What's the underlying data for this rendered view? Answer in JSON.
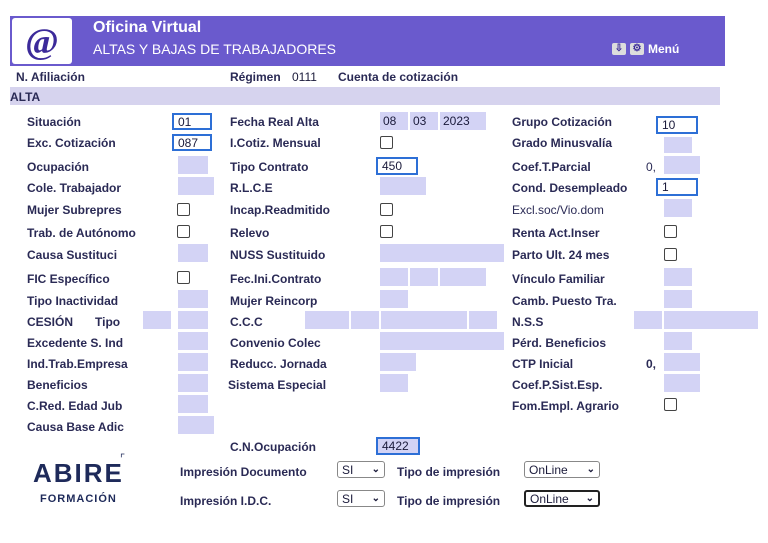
{
  "header": {
    "title": "Oficina Virtual",
    "subtitle": "ALTAS Y BAJAS DE TRABAJADORES",
    "menu_label": "Menú",
    "logo_text": "@"
  },
  "info_bar": {
    "afiliacion": "N. Afiliación",
    "regimen_label": "Régimen",
    "regimen_value": "0111",
    "cuenta": "Cuenta de cotización"
  },
  "section": "ALTA",
  "col1": {
    "situacion": "Situación",
    "situacion_value": "01",
    "exc_cotizacion": "Exc. Cotización",
    "exc_cotizacion_value": "087",
    "ocupacion": "Ocupación",
    "cole_trabajador": "Cole. Trabajador",
    "mujer_subrepres": "Mujer Subrepres",
    "trab_autonomo": "Trab. de Autónomo",
    "causa_sustituci": "Causa Sustituci",
    "fic": "FIC Específico",
    "tipo_inactividad": "Tipo Inactividad",
    "cesion": "CESIÓN",
    "tipo": "Tipo",
    "excedente": "Excedente S. Ind",
    "ind_trab": "Ind.Trab.Empresa",
    "beneficios": "Beneficios",
    "cred_edad": "C.Red. Edad Jub",
    "causa_base": "Causa Base Adic"
  },
  "col2": {
    "fecha_real_alta": "Fecha Real Alta",
    "fecha_d": "08",
    "fecha_m": "03",
    "fecha_y": "2023",
    "icotiz": "I.Cotiz. Mensual",
    "tipo_contrato": "Tipo Contrato",
    "tipo_contrato_value": "450",
    "rlce": "R.L.C.E",
    "incap": "Incap.Readmitido",
    "relevo": "Relevo",
    "nuss": "NUSS Sustituido",
    "fec_ini": "Fec.Ini.Contrato",
    "mujer_reincorp": "Mujer Reincorp",
    "ccc": "C.C.C",
    "convenio": "Convenio Colec",
    "reducc": "Reducc. Jornada",
    "sistema": "Sistema Especial",
    "cn_ocupacion": "C.N.Ocupación",
    "cn_ocupacion_value": "4422"
  },
  "col3": {
    "grupo": "Grupo Cotización",
    "grupo_value": "10",
    "grado": "Grado Minusvalía",
    "coef_parcial": "Coef.T.Parcial",
    "coef_parcial_value": "0,",
    "cond_desempleado": "Cond. Desempleado",
    "cond_desempleado_value": "1",
    "excl_soc": "Excl.soc/Vio.dom",
    "renta": "Renta Act.Inser",
    "parto": "Parto Ult. 24 mes",
    "vinculo": "Vínculo Familiar",
    "camb_puesto": "Camb. Puesto Tra.",
    "nss": "N.S.S",
    "perd_benef": "Pérd. Beneficios",
    "ctp": "CTP Inicial",
    "ctp_value": "0,",
    "coef_sist": "Coef.P.Sist.Esp.",
    "fom_empl": "Fom.Empl. Agrario"
  },
  "bottom": {
    "impresion_doc": "Impresión Documento",
    "impresion_doc_value": "SI",
    "impresion_idc": "Impresión I.D.C.",
    "impresion_idc_value": "SI",
    "tipo_impresion": "Tipo de impresión",
    "tipo_impresion_value_1": "OnLine",
    "tipo_impresion_value_2": "OnLine"
  },
  "brand": {
    "name": "ABIRE",
    "sub": "FORMACIÓN"
  }
}
